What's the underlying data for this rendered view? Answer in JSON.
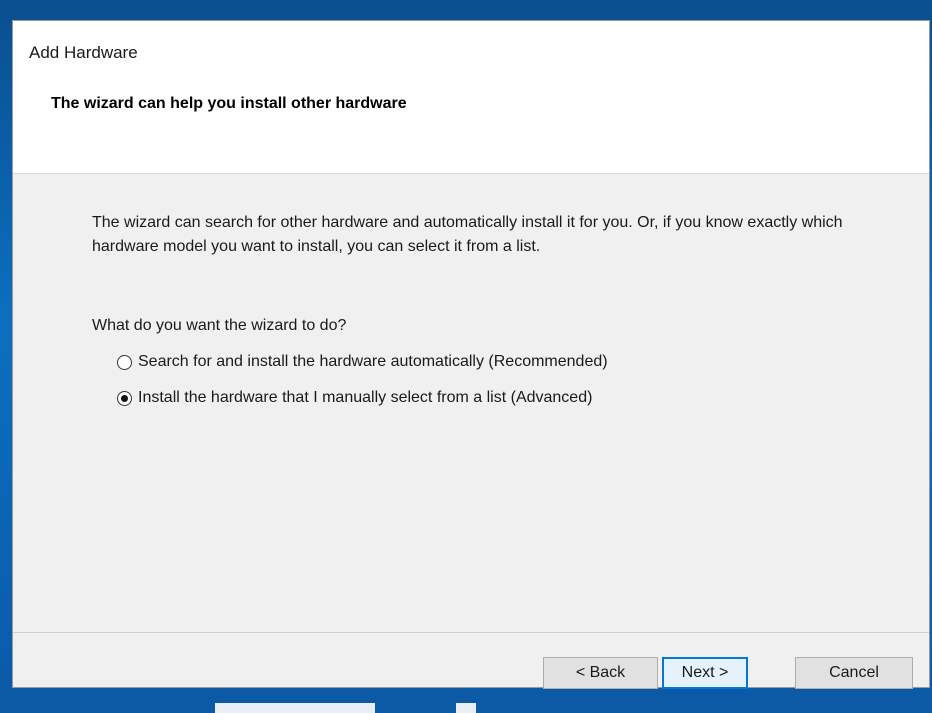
{
  "window": {
    "title": "Add Hardware"
  },
  "header": {
    "title": "The wizard can help you install other hardware"
  },
  "content": {
    "description": "The wizard can search for other hardware and automatically install it for you. Or, if you know exactly which hardware model you want to install, you can select it from a list.",
    "question": "What do you want the wizard to do?",
    "options": [
      {
        "label": "Search for and install the hardware automatically (Recommended)",
        "selected": false
      },
      {
        "label": "Install the hardware that I manually select from a list (Advanced)",
        "selected": true
      }
    ]
  },
  "buttons": {
    "back": "< Back",
    "next": "Next >",
    "cancel": "Cancel"
  },
  "colors": {
    "desktop_background": "#0b6fc0",
    "dialog_background": "#f0f0f0",
    "header_background": "#ffffff",
    "default_button_border": "#0078d7"
  }
}
